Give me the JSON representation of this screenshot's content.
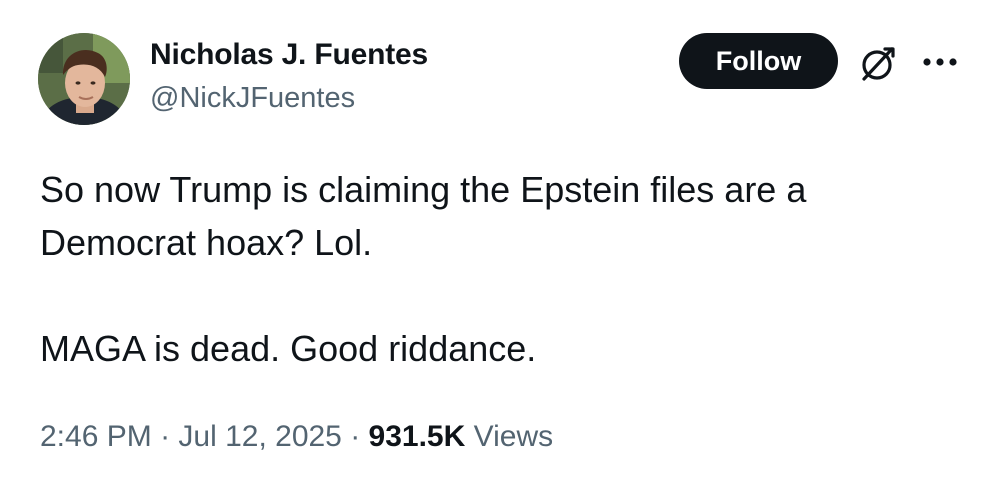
{
  "author": {
    "display_name": "Nicholas J. Fuentes",
    "handle": "@NickJFuentes"
  },
  "actions": {
    "follow_label": "Follow",
    "grok_icon": "grok-icon",
    "more_icon": "more-icon"
  },
  "tweet": {
    "line1": "So now Trump is claiming the Epstein files are a",
    "line2": "Democrat hoax? Lol.",
    "line3": "MAGA is dead. Good riddance."
  },
  "meta": {
    "time": "2:46 PM",
    "sep1": " · ",
    "date": "Jul 12, 2025",
    "sep2": " · ",
    "views_count": "931.5K",
    "views_label": " Views"
  },
  "colors": {
    "text": "#0f1419",
    "secondary": "#536471",
    "button_bg": "#0f1419",
    "button_text": "#ffffff"
  }
}
